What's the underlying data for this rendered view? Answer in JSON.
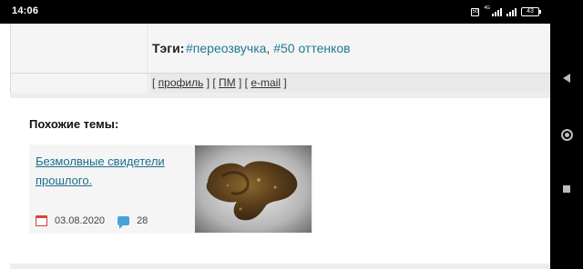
{
  "status_bar": {
    "time": "14:06",
    "sim_label": "50",
    "network_label": "4G",
    "battery": "43"
  },
  "post_info": {
    "tags_label": "Тэги:",
    "tags": [
      "#переозвучка",
      "#50 оттенков"
    ],
    "tags_separator": ", ",
    "links": {
      "open": "[ ",
      "profile": "профиль",
      "sep1": " ] [ ",
      "pm": "ПМ",
      "sep2": " ] [ ",
      "email": "e-mail",
      "close": " ]"
    }
  },
  "similar": {
    "heading": "Похожие темы:",
    "topics": [
      {
        "title": "Безмолвные свидетели прошлого.",
        "date": "03.08.2020",
        "comments": "28",
        "thumbnail": "rusty-artifact-photo"
      }
    ]
  },
  "nav_bar": {
    "back": "back-icon",
    "home": "home-icon",
    "recents": "recents-icon"
  },
  "colors": {
    "link": "#1f7a94",
    "topic_link": "#1f6d8c",
    "calendar": "#d9443c",
    "comment": "#4aa3d8"
  }
}
